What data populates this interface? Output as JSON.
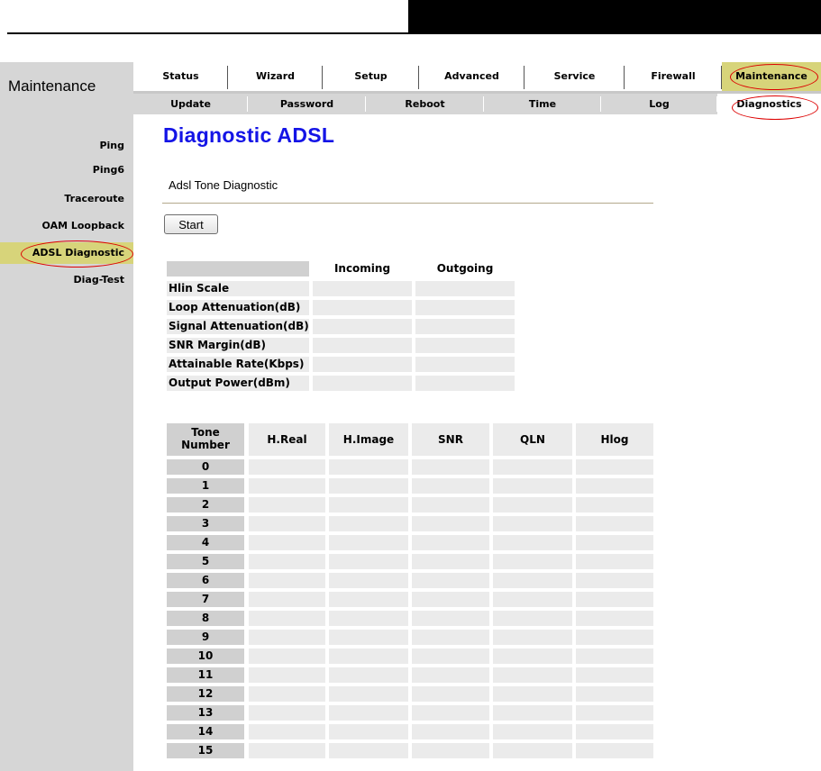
{
  "header": {
    "section_title": "Maintenance"
  },
  "nav": {
    "tabs": [
      {
        "label": "Status"
      },
      {
        "label": "Wizard"
      },
      {
        "label": "Setup"
      },
      {
        "label": "Advanced"
      },
      {
        "label": "Service"
      },
      {
        "label": "Firewall"
      },
      {
        "label": "Maintenance"
      }
    ],
    "subtabs": [
      {
        "label": "Update"
      },
      {
        "label": "Password"
      },
      {
        "label": "Reboot"
      },
      {
        "label": "Time"
      },
      {
        "label": "Log"
      },
      {
        "label": "Diagnostics"
      }
    ],
    "active_tab": "Maintenance",
    "active_subtab": "Diagnostics"
  },
  "sidebar": {
    "items": [
      {
        "label": "Ping"
      },
      {
        "label": "Ping6"
      },
      {
        "label": "Traceroute"
      },
      {
        "label": "OAM Loopback"
      },
      {
        "label": "ADSL Diagnostic"
      },
      {
        "label": "Diag-Test"
      }
    ],
    "active": "ADSL Diagnostic"
  },
  "main": {
    "title": "Diagnostic ADSL",
    "subtitle": "Adsl Tone Diagnostic",
    "start_label": "Start",
    "stats": {
      "headers": [
        "Incoming",
        "Outgoing"
      ],
      "rows": [
        {
          "label": "Hlin Scale",
          "incoming": "",
          "outgoing": ""
        },
        {
          "label": "Loop Attenuation(dB)",
          "incoming": "",
          "outgoing": ""
        },
        {
          "label": "Signal Attenuation(dB)",
          "incoming": "",
          "outgoing": ""
        },
        {
          "label": "SNR Margin(dB)",
          "incoming": "",
          "outgoing": ""
        },
        {
          "label": "Attainable Rate(Kbps)",
          "incoming": "",
          "outgoing": ""
        },
        {
          "label": "Output Power(dBm)",
          "incoming": "",
          "outgoing": ""
        }
      ]
    },
    "tones": {
      "headers": [
        "Tone Number",
        "H.Real",
        "H.Image",
        "SNR",
        "QLN",
        "Hlog"
      ],
      "rows": [
        "0",
        "1",
        "2",
        "3",
        "4",
        "5",
        "6",
        "7",
        "8",
        "9",
        "10",
        "11",
        "12",
        "13",
        "14",
        "15"
      ]
    }
  },
  "colors": {
    "accent_tab": "#d7d47a",
    "title_blue": "#1414e6",
    "highlight_ring": "#dd0000"
  }
}
